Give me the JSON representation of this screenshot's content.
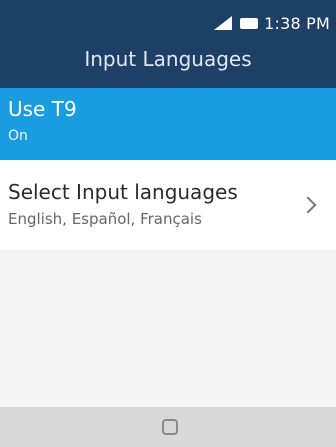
{
  "status_bar": {
    "time": "1:38 PM",
    "signal_icon": "signal-icon",
    "battery_icon": "battery-icon"
  },
  "header": {
    "title": "Input Languages"
  },
  "settings": [
    {
      "title": "Use T9",
      "subtitle": "On",
      "selected": true
    },
    {
      "title": "Select Input languages",
      "subtitle": "English, Español, Français",
      "chevron_icon": "chevron-right-icon"
    }
  ],
  "softkey": {
    "center_icon": "home-icon"
  },
  "colors": {
    "header_bg": "#1e3f66",
    "selected_bg": "#1a9de0",
    "softkey_bg": "#d9d9d9"
  }
}
